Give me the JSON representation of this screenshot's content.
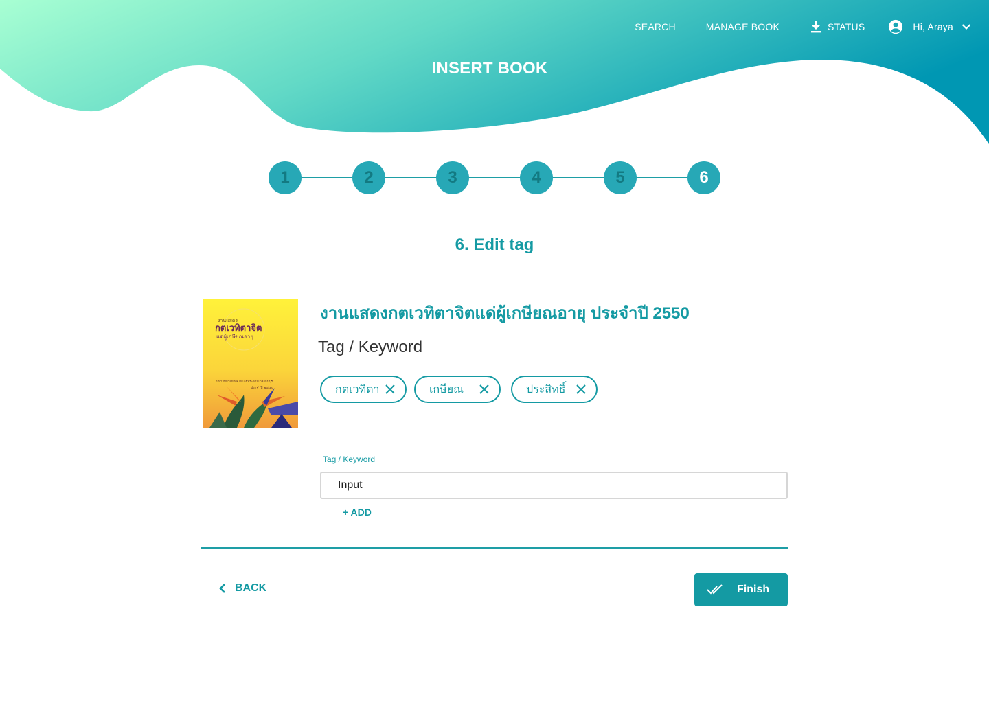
{
  "nav": {
    "search": "SEARCH",
    "manage_book": "MANAGE BOOK",
    "status": "STATUS",
    "user_greeting": "Hi, Araya"
  },
  "header": {
    "title": "INSERT BOOK"
  },
  "stepper": {
    "steps": [
      "1",
      "2",
      "3",
      "4",
      "5",
      "6"
    ],
    "current": 6
  },
  "section": {
    "title": "6. Edit tag"
  },
  "book": {
    "title": "งานแสดงกตเวทิตาจิตแด่ผู้เกษียณอายุ ประจำปี 2550",
    "cover": {
      "line1": "งานแสดง",
      "line2": "กตเวทิตาจิต",
      "line3": "แด่ผู้เกษียณอายุ",
      "line4": "มหาวิทยาลัยเทคโนโลยีพระจอมเกล้าธนบุรี",
      "line5": "ประจำปี ๒๕๕๐"
    }
  },
  "tags_section": {
    "heading": "Tag / Keyword",
    "tags": [
      "กตเวทิตา",
      "เกษียณ",
      "ประสิทธิ์"
    ]
  },
  "input": {
    "label": "Tag / Keyword",
    "value": "Input"
  },
  "actions": {
    "add": "+ ADD",
    "back": "BACK",
    "finish": "Finish"
  },
  "colors": {
    "primary": "#149aa3",
    "gradient_start": "#a8ffd3",
    "gradient_end": "#0097b3"
  },
  "icons": {
    "status": "download-icon",
    "user": "account-circle-icon",
    "user_menu": "chevron-down-icon",
    "tag_remove": "close-icon",
    "back": "chevron-left-icon",
    "finish": "double-check-icon"
  }
}
